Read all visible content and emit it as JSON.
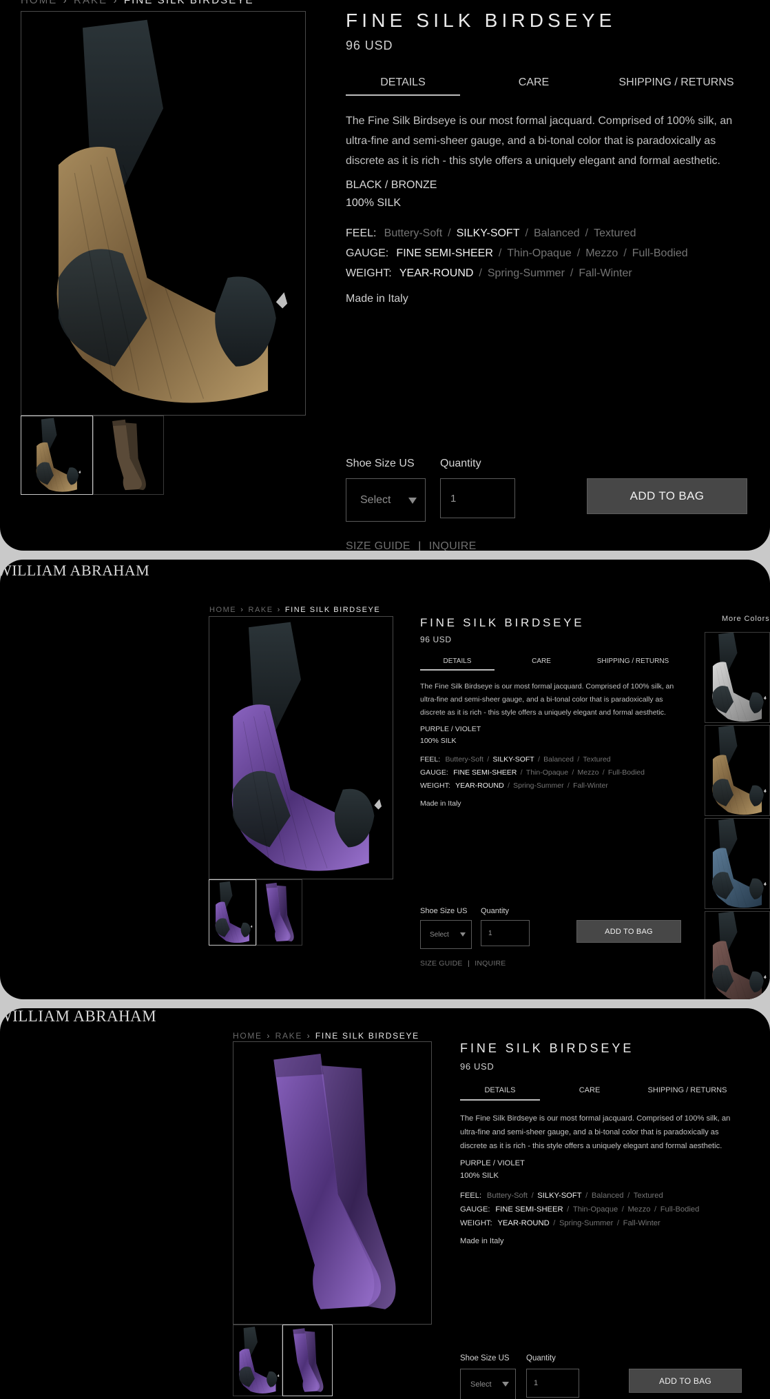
{
  "brand": "WILLIAM ABRAHAM",
  "breadcrumb": {
    "home": "HOME",
    "category": "RAKE",
    "current": "FINE SILK BIRDSEYE"
  },
  "product": {
    "title": "FINE SILK BIRDSEYE",
    "price": "96 USD",
    "tabs": {
      "details": "DETAILS",
      "care": "CARE",
      "shipping": "SHIPPING / RETURNS"
    },
    "description": "The Fine Silk Birdseye is our most formal jacquard.  Comprised of 100% silk, an ultra-fine and semi-sheer gauge, and a bi-tonal color that is paradoxically as discrete as it is rich - this style offers a uniquely elegant and formal aesthetic.",
    "material": "100% SILK",
    "feel": {
      "label": "FEEL:",
      "options": [
        "Buttery-Soft",
        "SILKY-SOFT",
        "Balanced",
        "Textured"
      ],
      "selected": 1
    },
    "gauge": {
      "label": "GAUGE:",
      "options": [
        "FINE SEMI-SHEER",
        "Thin-Opaque",
        "Mezzo",
        "Full-Bodied"
      ],
      "selected": 0
    },
    "weight": {
      "label": "WEIGHT:",
      "options": [
        "YEAR-ROUND",
        "Spring-Summer",
        "Fall-Winter"
      ],
      "selected": 0
    },
    "made_in": "Made in Italy"
  },
  "views": [
    {
      "color": "BLACK / BRONZE"
    },
    {
      "color": "PURPLE / VIOLET"
    },
    {
      "color": "PURPLE / VIOLET"
    }
  ],
  "purchase": {
    "size_label": "Shoe Size US",
    "size_value": "Select",
    "quantity_label": "Quantity",
    "quantity_value": "1",
    "add_to_bag": "ADD TO BAG"
  },
  "links": {
    "size_guide": "SIZE GUIDE",
    "inquire": "INQUIRE"
  },
  "more_colors": {
    "label": "More Colors",
    "swatches": [
      "grey-sock",
      "bronze-sock",
      "blue-sock",
      "brown-sock"
    ]
  },
  "icons": {
    "dropdown": "chevron-down-icon"
  },
  "colors": {
    "background": "#000000",
    "button": "#474747",
    "bronze": "#8a6f45",
    "purple": "#6a4a96",
    "toe": "#222a30"
  }
}
